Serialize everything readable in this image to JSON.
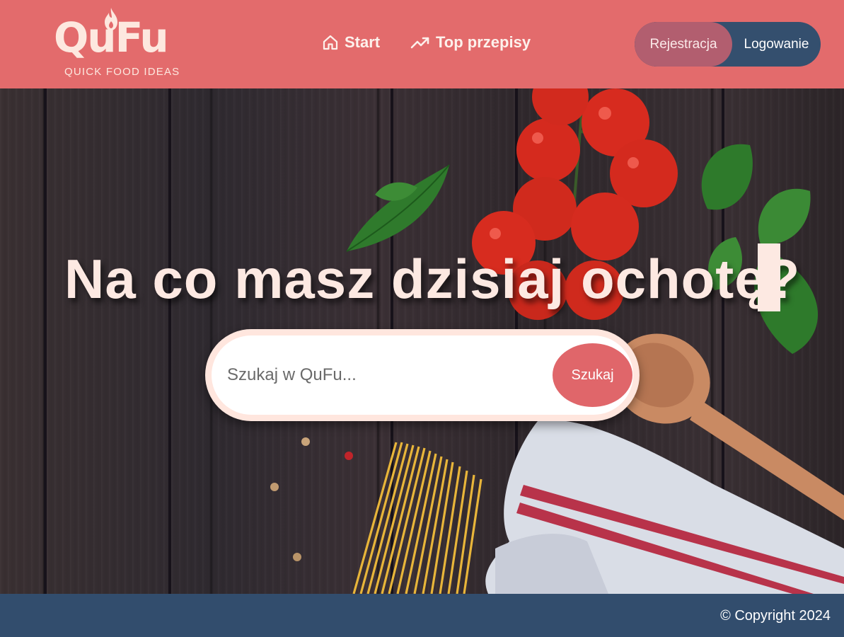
{
  "brand": {
    "name": "QuFu",
    "tagline": "QUICK FOOD IDEAS"
  },
  "nav": {
    "start_label": "Start",
    "top_label": "Top przepisy"
  },
  "auth": {
    "register_label": "Rejestracja",
    "login_label": "Logowanie"
  },
  "hero": {
    "headline": "Na co masz dzisiaj ochotę?"
  },
  "search": {
    "placeholder": "Szukaj w QuFu...",
    "button_label": "Szukaj"
  },
  "footer": {
    "copyright": "© Copyright 2024"
  },
  "colors": {
    "header_bg": "#e36b6c",
    "footer_bg": "#324d6d",
    "accent": "#e0666a",
    "cream": "#fde9e2"
  }
}
